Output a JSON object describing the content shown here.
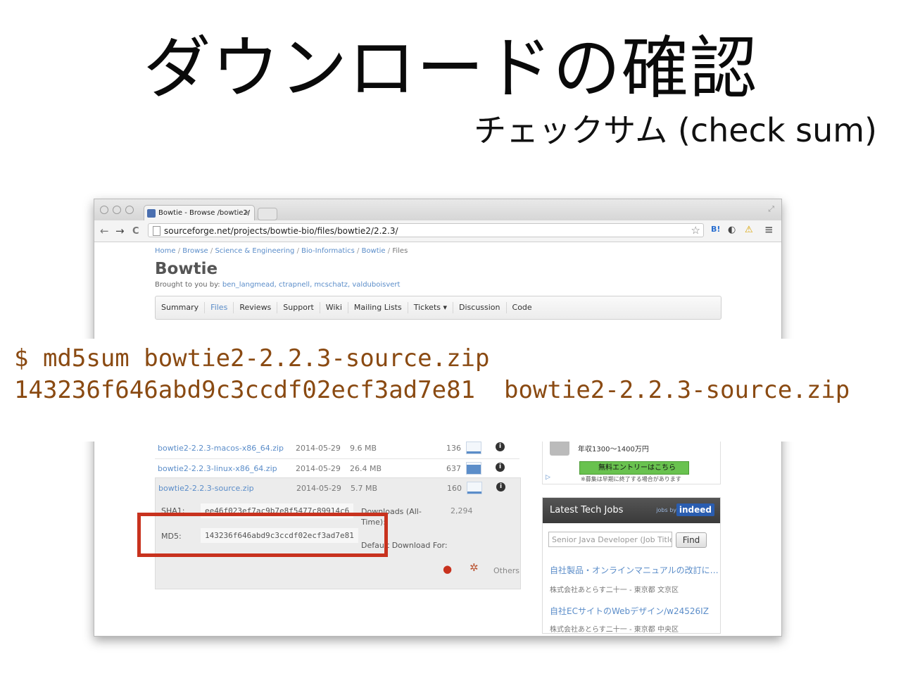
{
  "slide": {
    "title": "ダウンロードの確認",
    "subtitle": "チェックサム (check sum)"
  },
  "browser": {
    "tab_title": "Bowtie - Browse /bowtie2/",
    "tab_close": "×",
    "url": "sourceforge.net/projects/bowtie-bio/files/bowtie2/2.2.3/",
    "nav_back": "←",
    "nav_forward": "→",
    "nav_reload": "C",
    "star": "☆",
    "ext_hatena": "B!",
    "ext_warning": "⚠",
    "menu": "≡"
  },
  "page": {
    "breadcrumb": [
      "Home",
      "Browse",
      "Science & Engineering",
      "Bio-Informatics",
      "Bowtie",
      "Files"
    ],
    "breadcrumb_sep": "/",
    "project_name": "Bowtie",
    "brought_by_label": "Brought to you by:",
    "brought_by_authors": "ben_langmead, ctrapnell, mcschatz, valduboisvert",
    "tabs": [
      "Summary",
      "Files",
      "Reviews",
      "Support",
      "Wiki",
      "Mailing Lists",
      "Tickets ▾",
      "Discussion",
      "Code"
    ],
    "active_tab": "Files"
  },
  "terminal": {
    "line1": "$ md5sum bowtie2-2.2.3-source.zip",
    "line2": "143236f646abd9c3ccdf02ecf3ad7e81  bowtie2-2.2.3-source.zip"
  },
  "files": [
    {
      "name": "bowtie2-2.2.3-macos-x86_64.zip",
      "date": "2014-05-29",
      "size": "9.6 MB",
      "downloads": "136",
      "spark_level": 0.2
    },
    {
      "name": "bowtie2-2.2.3-linux-x86_64.zip",
      "date": "2014-05-29",
      "size": "26.4 MB",
      "downloads": "637",
      "spark_level": 0.8
    },
    {
      "name": "bowtie2-2.2.3-source.zip",
      "date": "2014-05-29",
      "size": "5.7 MB",
      "downloads": "160",
      "spark_level": 0.2
    }
  ],
  "file_details": {
    "sha1_label": "SHA1:",
    "sha1_value": "ee46f023ef7ac9b7e8f5477c89914c6",
    "md5_label": "MD5:",
    "md5_value": "143236f646abd9c3ccdf02ecf3ad7e81",
    "downloads_label": "Downloads (All-Time):",
    "downloads_value": "2,294",
    "default_download_label": "Default Download For:",
    "others_label": "Others"
  },
  "sidebar": {
    "ad_salary": "年収1300〜1400万円",
    "ad_button": "無料エントリーはこちら",
    "ad_note": "※募集は早期に終了する場合があります",
    "jobs_title": "Latest Tech Jobs",
    "jobs_by": "jobs by",
    "jobs_brand": "indeed",
    "search_placeholder": "Senior Java Developer (Job Title",
    "find_button": "Find",
    "job1_title": "自社製品・オンラインマニュアルの改訂に…",
    "job1_company": "株式会社あとらす二十一 - 東京都 文京区",
    "job2_title": "自社ECサイトのWebデザイン/w24526IZ",
    "job2_company": "株式会社あとらす二十一 - 東京都 中央区"
  },
  "colors": {
    "link": "#5b8dc9",
    "terminal_text": "#8a4a12",
    "highlight_box": "#c8321e"
  }
}
